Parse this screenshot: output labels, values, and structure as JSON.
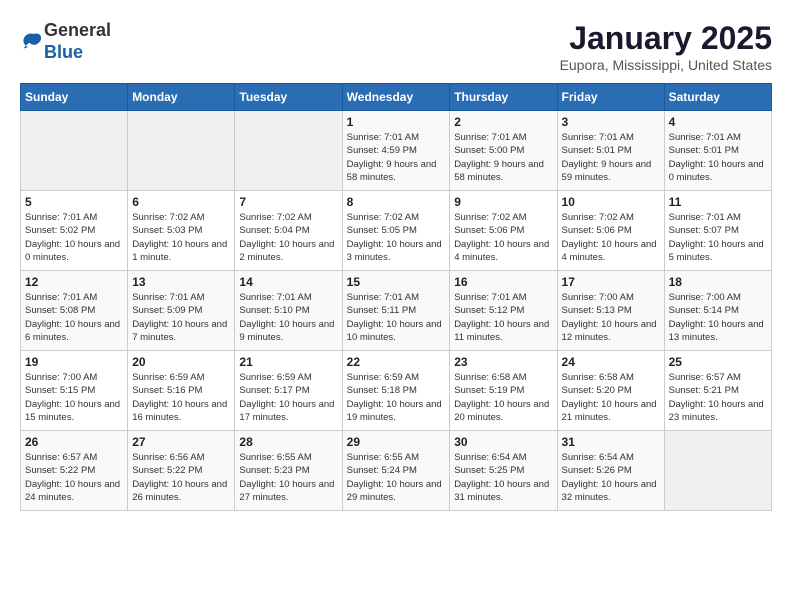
{
  "header": {
    "logo_general": "General",
    "logo_blue": "Blue",
    "month_title": "January 2025",
    "location": "Eupora, Mississippi, United States"
  },
  "days_of_week": [
    "Sunday",
    "Monday",
    "Tuesday",
    "Wednesday",
    "Thursday",
    "Friday",
    "Saturday"
  ],
  "weeks": [
    [
      {
        "day": null
      },
      {
        "day": null
      },
      {
        "day": null
      },
      {
        "day": 1,
        "sunrise": "Sunrise: 7:01 AM",
        "sunset": "Sunset: 4:59 PM",
        "daylight": "Daylight: 9 hours and 58 minutes."
      },
      {
        "day": 2,
        "sunrise": "Sunrise: 7:01 AM",
        "sunset": "Sunset: 5:00 PM",
        "daylight": "Daylight: 9 hours and 58 minutes."
      },
      {
        "day": 3,
        "sunrise": "Sunrise: 7:01 AM",
        "sunset": "Sunset: 5:01 PM",
        "daylight": "Daylight: 9 hours and 59 minutes."
      },
      {
        "day": 4,
        "sunrise": "Sunrise: 7:01 AM",
        "sunset": "Sunset: 5:01 PM",
        "daylight": "Daylight: 10 hours and 0 minutes."
      }
    ],
    [
      {
        "day": 5,
        "sunrise": "Sunrise: 7:01 AM",
        "sunset": "Sunset: 5:02 PM",
        "daylight": "Daylight: 10 hours and 0 minutes."
      },
      {
        "day": 6,
        "sunrise": "Sunrise: 7:02 AM",
        "sunset": "Sunset: 5:03 PM",
        "daylight": "Daylight: 10 hours and 1 minute."
      },
      {
        "day": 7,
        "sunrise": "Sunrise: 7:02 AM",
        "sunset": "Sunset: 5:04 PM",
        "daylight": "Daylight: 10 hours and 2 minutes."
      },
      {
        "day": 8,
        "sunrise": "Sunrise: 7:02 AM",
        "sunset": "Sunset: 5:05 PM",
        "daylight": "Daylight: 10 hours and 3 minutes."
      },
      {
        "day": 9,
        "sunrise": "Sunrise: 7:02 AM",
        "sunset": "Sunset: 5:06 PM",
        "daylight": "Daylight: 10 hours and 4 minutes."
      },
      {
        "day": 10,
        "sunrise": "Sunrise: 7:02 AM",
        "sunset": "Sunset: 5:06 PM",
        "daylight": "Daylight: 10 hours and 4 minutes."
      },
      {
        "day": 11,
        "sunrise": "Sunrise: 7:01 AM",
        "sunset": "Sunset: 5:07 PM",
        "daylight": "Daylight: 10 hours and 5 minutes."
      }
    ],
    [
      {
        "day": 12,
        "sunrise": "Sunrise: 7:01 AM",
        "sunset": "Sunset: 5:08 PM",
        "daylight": "Daylight: 10 hours and 6 minutes."
      },
      {
        "day": 13,
        "sunrise": "Sunrise: 7:01 AM",
        "sunset": "Sunset: 5:09 PM",
        "daylight": "Daylight: 10 hours and 7 minutes."
      },
      {
        "day": 14,
        "sunrise": "Sunrise: 7:01 AM",
        "sunset": "Sunset: 5:10 PM",
        "daylight": "Daylight: 10 hours and 9 minutes."
      },
      {
        "day": 15,
        "sunrise": "Sunrise: 7:01 AM",
        "sunset": "Sunset: 5:11 PM",
        "daylight": "Daylight: 10 hours and 10 minutes."
      },
      {
        "day": 16,
        "sunrise": "Sunrise: 7:01 AM",
        "sunset": "Sunset: 5:12 PM",
        "daylight": "Daylight: 10 hours and 11 minutes."
      },
      {
        "day": 17,
        "sunrise": "Sunrise: 7:00 AM",
        "sunset": "Sunset: 5:13 PM",
        "daylight": "Daylight: 10 hours and 12 minutes."
      },
      {
        "day": 18,
        "sunrise": "Sunrise: 7:00 AM",
        "sunset": "Sunset: 5:14 PM",
        "daylight": "Daylight: 10 hours and 13 minutes."
      }
    ],
    [
      {
        "day": 19,
        "sunrise": "Sunrise: 7:00 AM",
        "sunset": "Sunset: 5:15 PM",
        "daylight": "Daylight: 10 hours and 15 minutes."
      },
      {
        "day": 20,
        "sunrise": "Sunrise: 6:59 AM",
        "sunset": "Sunset: 5:16 PM",
        "daylight": "Daylight: 10 hours and 16 minutes."
      },
      {
        "day": 21,
        "sunrise": "Sunrise: 6:59 AM",
        "sunset": "Sunset: 5:17 PM",
        "daylight": "Daylight: 10 hours and 17 minutes."
      },
      {
        "day": 22,
        "sunrise": "Sunrise: 6:59 AM",
        "sunset": "Sunset: 5:18 PM",
        "daylight": "Daylight: 10 hours and 19 minutes."
      },
      {
        "day": 23,
        "sunrise": "Sunrise: 6:58 AM",
        "sunset": "Sunset: 5:19 PM",
        "daylight": "Daylight: 10 hours and 20 minutes."
      },
      {
        "day": 24,
        "sunrise": "Sunrise: 6:58 AM",
        "sunset": "Sunset: 5:20 PM",
        "daylight": "Daylight: 10 hours and 21 minutes."
      },
      {
        "day": 25,
        "sunrise": "Sunrise: 6:57 AM",
        "sunset": "Sunset: 5:21 PM",
        "daylight": "Daylight: 10 hours and 23 minutes."
      }
    ],
    [
      {
        "day": 26,
        "sunrise": "Sunrise: 6:57 AM",
        "sunset": "Sunset: 5:22 PM",
        "daylight": "Daylight: 10 hours and 24 minutes."
      },
      {
        "day": 27,
        "sunrise": "Sunrise: 6:56 AM",
        "sunset": "Sunset: 5:22 PM",
        "daylight": "Daylight: 10 hours and 26 minutes."
      },
      {
        "day": 28,
        "sunrise": "Sunrise: 6:55 AM",
        "sunset": "Sunset: 5:23 PM",
        "daylight": "Daylight: 10 hours and 27 minutes."
      },
      {
        "day": 29,
        "sunrise": "Sunrise: 6:55 AM",
        "sunset": "Sunset: 5:24 PM",
        "daylight": "Daylight: 10 hours and 29 minutes."
      },
      {
        "day": 30,
        "sunrise": "Sunrise: 6:54 AM",
        "sunset": "Sunset: 5:25 PM",
        "daylight": "Daylight: 10 hours and 31 minutes."
      },
      {
        "day": 31,
        "sunrise": "Sunrise: 6:54 AM",
        "sunset": "Sunset: 5:26 PM",
        "daylight": "Daylight: 10 hours and 32 minutes."
      },
      {
        "day": null
      }
    ]
  ]
}
